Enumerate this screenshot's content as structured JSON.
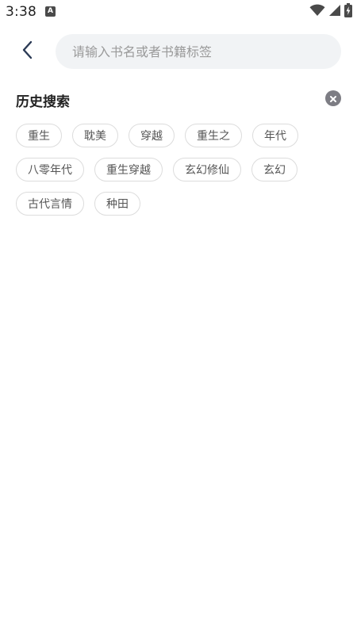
{
  "status_bar": {
    "time": "3:38",
    "notification_icon": "a-icon",
    "icons": [
      "wifi-icon",
      "signal-icon",
      "battery-charging-icon"
    ]
  },
  "header": {
    "back_icon": "chevron-left-icon",
    "search_placeholder": "请输入书名或者书籍标签",
    "search_value": ""
  },
  "history": {
    "title": "历史搜索",
    "clear_icon": "close-circle-icon",
    "tag_rows": [
      [
        "重生",
        "耽美",
        "穿越",
        "重生之",
        "年代"
      ],
      [
        "八零年代",
        "重生穿越",
        "玄幻修仙",
        "玄幻"
      ],
      [
        "古代言情",
        "种田"
      ]
    ]
  },
  "colors": {
    "background": "#ffffff",
    "search_bg": "#f1f3f5",
    "tag_border": "#dcdcdc",
    "tag_text": "#555555",
    "title_text": "#222222",
    "placeholder_text": "#9a9a9a",
    "back_arrow": "#2b3a55",
    "clear_icon_bg": "#7d7d84"
  }
}
